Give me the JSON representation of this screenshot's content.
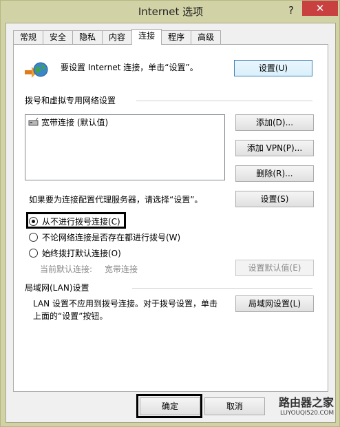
{
  "window": {
    "title": "Internet 选项",
    "help_glyph": "?",
    "close_glyph": "✕"
  },
  "tabs": [
    {
      "label": "常规"
    },
    {
      "label": "安全"
    },
    {
      "label": "隐私"
    },
    {
      "label": "内容"
    },
    {
      "label": "连接",
      "active": true
    },
    {
      "label": "程序"
    },
    {
      "label": "高级"
    }
  ],
  "setup": {
    "text": "要设置 Internet 连接，单击“设置”。",
    "button": "设置(U)"
  },
  "dialup": {
    "heading": "拨号和虚拟专用网络设置",
    "list_items": [
      "宽带连接 (默认值)"
    ],
    "add_button": "添加(D)...",
    "add_vpn_button": "添加 VPN(P)...",
    "remove_button": "删除(R)...",
    "proxy_text": "如果要为连接配置代理服务器，请选择“设置”。",
    "settings_button": "设置(S)",
    "radios": [
      {
        "label": "从不进行拨号连接(C)",
        "checked": true
      },
      {
        "label": "不论网络连接是否存在都进行拨号(W)",
        "checked": false
      },
      {
        "label": "始终拨打默认连接(O)",
        "checked": false
      }
    ],
    "current_default_label": "当前默认连接:",
    "current_default_value": "宽带连接",
    "set_default_button": "设置默认值(E)"
  },
  "lan": {
    "heading": "局域网(LAN)设置",
    "text_line1": "LAN 设置不应用到拨号连接。对于拨号设置，单击",
    "text_line2": "上面的“设置”按钮。",
    "button": "局域网设置(L)"
  },
  "footer": {
    "ok": "确定",
    "cancel": "取消",
    "watermark_cn": "路由器之家",
    "watermark_url": "LUYOUQI520.COM"
  },
  "colors": {
    "frame": "#d1d2a6",
    "close_red": "#c94040",
    "highlight": "#000000"
  }
}
